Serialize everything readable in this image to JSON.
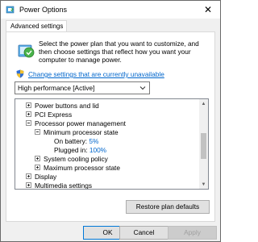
{
  "window": {
    "title": "Power Options",
    "close_glyph": "✕",
    "icon": "power-options-icon"
  },
  "tab": {
    "label": "Advanced settings"
  },
  "intro": {
    "text": "Select the power plan that you want to customize, and then choose settings that reflect how you want your computer to manage power.",
    "icon": "power-plan-icon"
  },
  "change_link": {
    "label": "Change settings that are currently unavailable",
    "icon": "uac-shield-icon"
  },
  "plan_select": {
    "value": "High performance [Active]",
    "chevron": "⌄"
  },
  "tree": {
    "items": [
      {
        "label": "Power buttons and lid",
        "expander": "+"
      },
      {
        "label": "PCI Express",
        "expander": "+"
      },
      {
        "label": "Processor power management",
        "expander": "−"
      },
      {
        "label": "Minimum processor state",
        "expander": "−"
      },
      {
        "label": "On battery:",
        "value": "5%"
      },
      {
        "label": "Plugged in:",
        "value": "100%"
      },
      {
        "label": "System cooling policy",
        "expander": "+"
      },
      {
        "label": "Maximum processor state",
        "expander": "+"
      },
      {
        "label": "Display",
        "expander": "+"
      },
      {
        "label": "Multimedia settings",
        "expander": "+"
      }
    ]
  },
  "buttons": {
    "restore": "Restore plan defaults",
    "ok": "OK",
    "cancel": "Cancel",
    "apply": "Apply"
  },
  "colors": {
    "link": "#0066cc",
    "focus_border": "#0078d7"
  }
}
